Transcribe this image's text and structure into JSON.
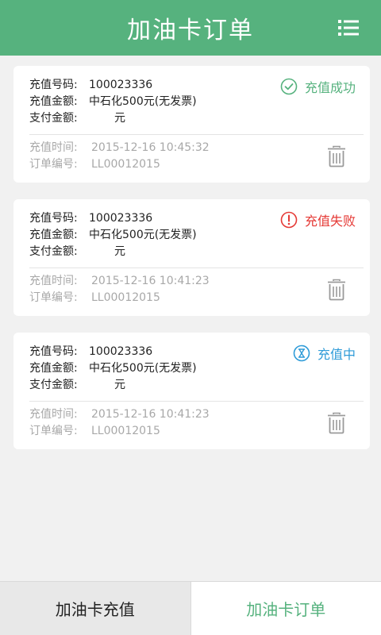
{
  "header": {
    "title": "加油卡订单"
  },
  "labels": {
    "card_no": "充值号码:",
    "amount": "充值金额:",
    "paid": "支付金额:",
    "time": "充值时间:",
    "order_no": "订单编号:"
  },
  "orders": [
    {
      "card_no": "100023336",
      "amount": "中石化500元(无发票)",
      "paid": "元",
      "status": "充值成功",
      "status_icon": "check-circle-icon",
      "status_color": "#56b27e",
      "time": "2015-12-16   10:45:32",
      "order_no": "LL00012015"
    },
    {
      "card_no": "100023336",
      "amount": "中石化500元(无发票)",
      "paid": "元",
      "status": "充值失败",
      "status_icon": "exclamation-circle-icon",
      "status_color": "#e53935",
      "time": "2015-12-16   10:41:23",
      "order_no": "LL00012015"
    },
    {
      "card_no": "100023336",
      "amount": "中石化500元(无发票)",
      "paid": "元",
      "status": "充值中",
      "status_icon": "hourglass-icon",
      "status_color": "#2e9bd8",
      "time": "2015-12-16   10:41:23",
      "order_no": "LL00012015"
    }
  ],
  "tabs": [
    {
      "label": "加油卡充值",
      "active": false
    },
    {
      "label": "加油卡订单",
      "active": true
    }
  ],
  "colors": {
    "accent": "#56b27e",
    "background": "#f1f1f1"
  }
}
